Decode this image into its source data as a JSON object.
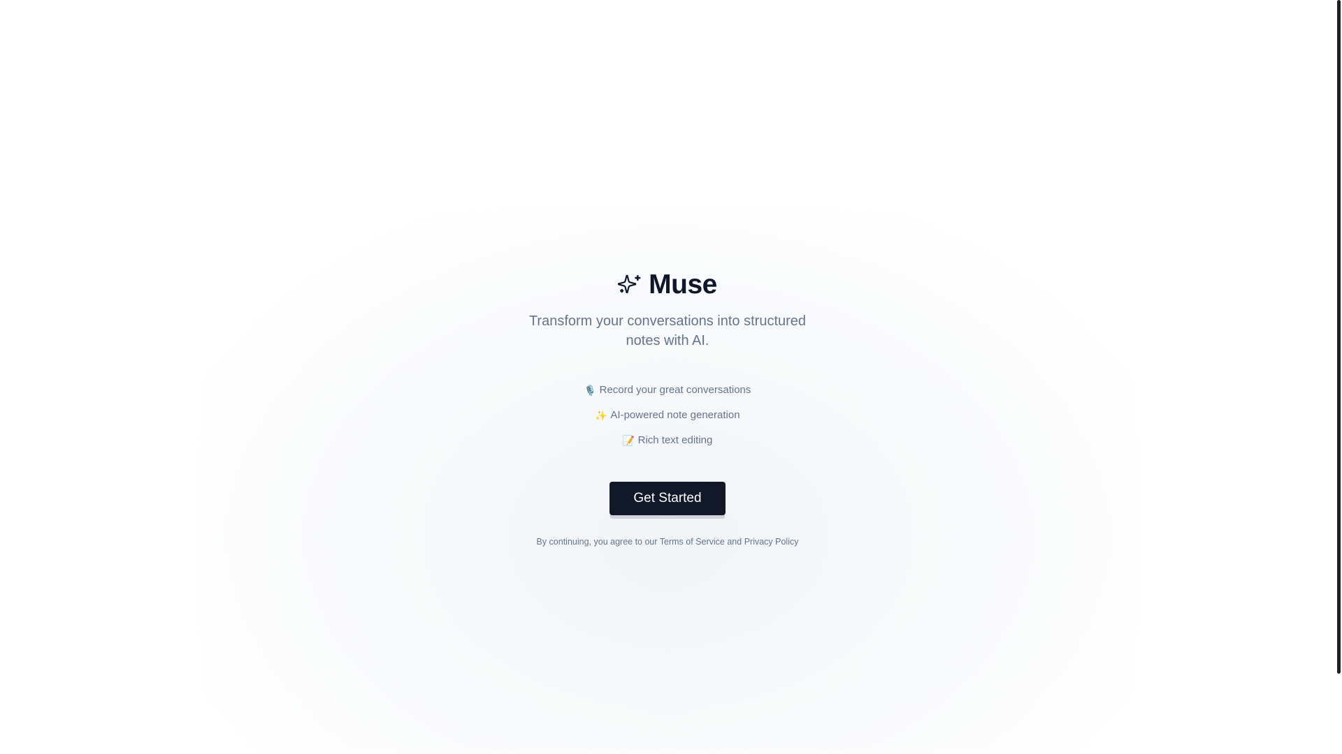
{
  "brand": {
    "name": "Muse",
    "icon": "sparkles-icon"
  },
  "tagline": "Transform your conversations into structured notes with AI.",
  "features": [
    {
      "icon": "🎙️",
      "icon_name": "microphone-icon",
      "label": "Record your great conversations"
    },
    {
      "icon": "✨",
      "icon_name": "sparkles-icon",
      "label": "AI-powered note generation"
    },
    {
      "icon": "📝",
      "icon_name": "memo-icon",
      "label": "Rich text editing"
    }
  ],
  "cta": {
    "label": "Get Started"
  },
  "legal": {
    "prefix": "By continuing, you agree to our ",
    "terms": "Terms of Service",
    "conjunction": " and ",
    "privacy": "Privacy Policy"
  },
  "colors": {
    "brand_text": "#0f172a",
    "muted_text": "#64748b",
    "button_bg": "#111827",
    "button_text": "#ffffff"
  }
}
